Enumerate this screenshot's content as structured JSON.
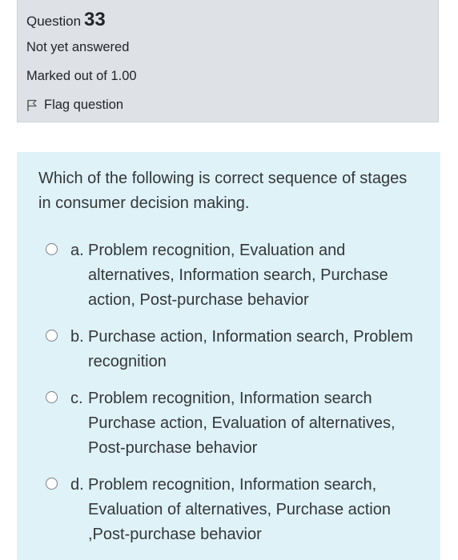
{
  "info": {
    "question_label": "Question",
    "question_number": "33",
    "state": "Not yet answered",
    "grade": "Marked out of 1.00",
    "flag_label": "Flag question"
  },
  "question": {
    "text": "Which of the following is correct sequence of stages in consumer decision making.",
    "answers": [
      {
        "letter": "a.",
        "text": "Problem recognition, Evaluation and alternatives, Information search, Purchase action, Post-purchase behavior"
      },
      {
        "letter": "b.",
        "text": "Purchase action, Information search, Problem recognition"
      },
      {
        "letter": "c.",
        "text": "Problem recognition, Information search Purchase action, Evaluation of alternatives, Post-purchase behavior"
      },
      {
        "letter": "d.",
        "text": "Problem recognition, Information search, Evaluation of alternatives, Purchase action ,Post-purchase behavior"
      }
    ]
  },
  "colors": {
    "info_panel_bg": "#dee2e6",
    "question_bg": "#def2f8",
    "text": "#34373a"
  },
  "icons": {
    "flag": "flag-icon",
    "radio": "radio-unchecked"
  }
}
